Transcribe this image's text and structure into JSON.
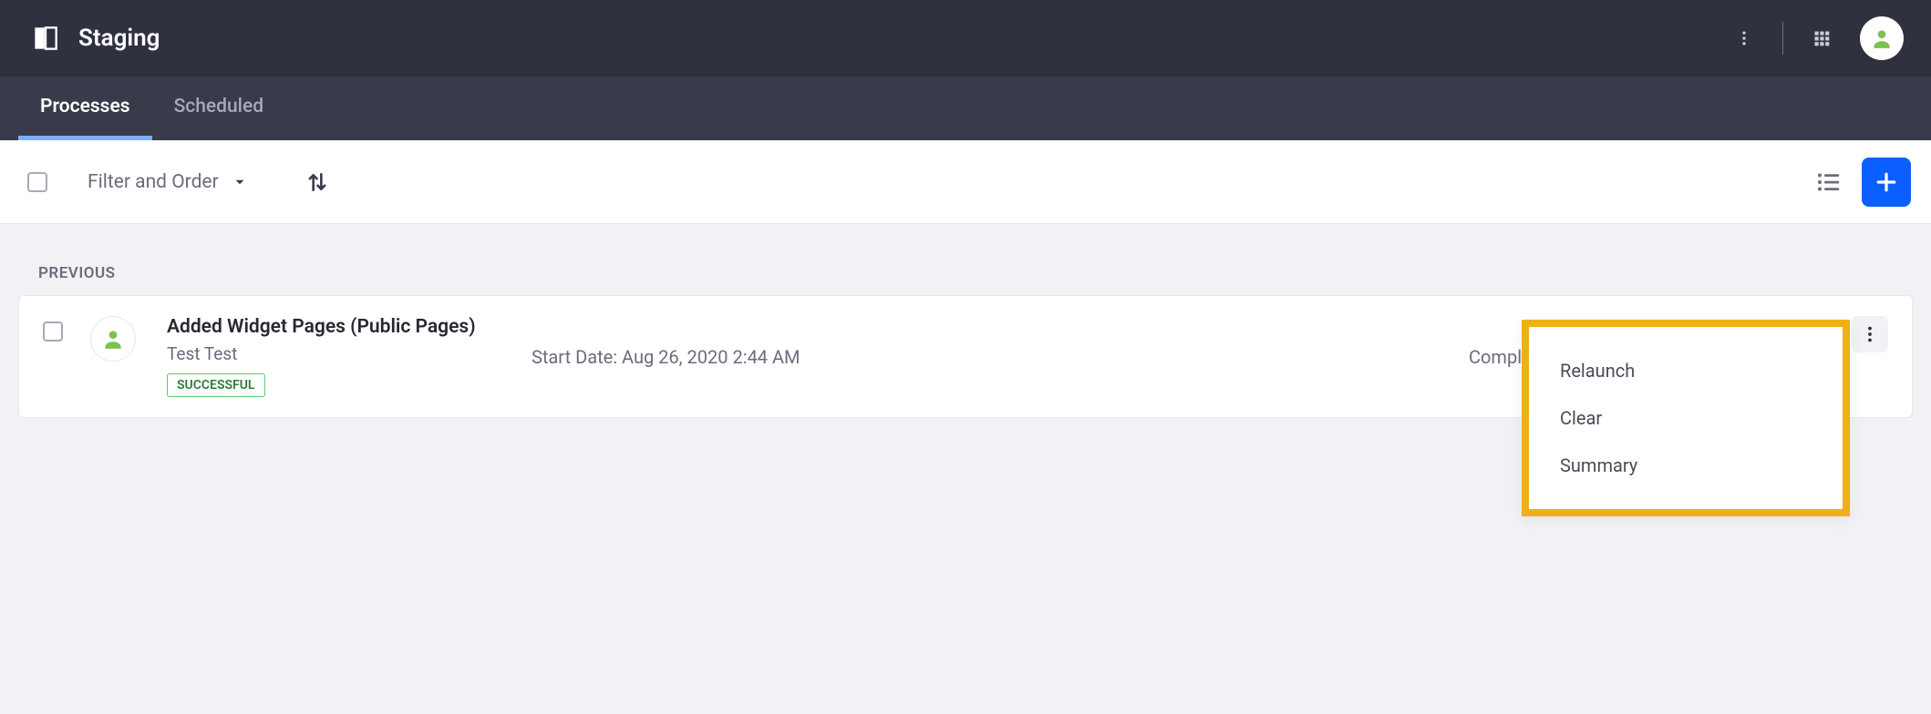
{
  "header": {
    "title": "Staging"
  },
  "tabs": [
    {
      "label": "Processes",
      "active": true
    },
    {
      "label": "Scheduled",
      "active": false
    }
  ],
  "toolbar": {
    "filter_label": "Filter and Order"
  },
  "section": {
    "label": "PREVIOUS"
  },
  "rows": [
    {
      "title": "Added Widget Pages (Public Pages)",
      "subtitle": "Test Test",
      "badge": "SUCCESSFUL",
      "start_date": "Start Date: Aug 26, 2020 2:44 AM",
      "status": "Comple"
    }
  ],
  "dropdown": {
    "items": [
      "Relaunch",
      "Clear",
      "Summary"
    ]
  }
}
